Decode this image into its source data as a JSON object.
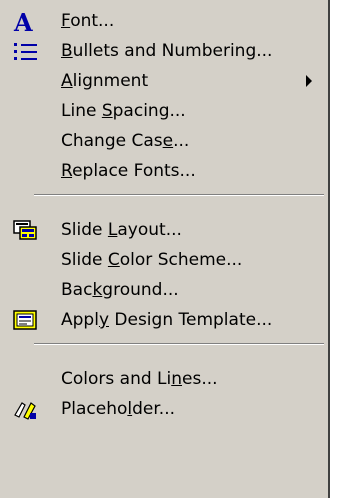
{
  "menu": {
    "items": [
      {
        "label": "Font...",
        "mnemonic": 0,
        "icon": "font-icon"
      },
      {
        "label": "Bullets and Numbering...",
        "mnemonic": 0,
        "icon": "bullets-icon"
      },
      {
        "label": "Alignment",
        "mnemonic": 0,
        "submenu": true
      },
      {
        "label": "Line Spacing...",
        "mnemonic": 5
      },
      {
        "label": "Change Case...",
        "mnemonic": 10
      },
      {
        "label": "Replace Fonts...",
        "mnemonic": 0
      },
      {
        "label": "Slide Layout...",
        "mnemonic": 6,
        "icon": "slide-layout-icon"
      },
      {
        "label": "Slide Color Scheme...",
        "mnemonic": 6
      },
      {
        "label": "Background...",
        "mnemonic": 3
      },
      {
        "label": "Apply Design Template...",
        "mnemonic": 4,
        "icon": "design-template-icon"
      },
      {
        "label": "Colors and Lines...",
        "mnemonic": 13
      },
      {
        "label": "Placeholder...",
        "mnemonic": 7,
        "icon": "placeholder-icon"
      }
    ]
  },
  "colors": {
    "menu_bg": "#d4d0c8",
    "font_icon": "#0000a8",
    "bullets_icon": "#0000a8"
  }
}
